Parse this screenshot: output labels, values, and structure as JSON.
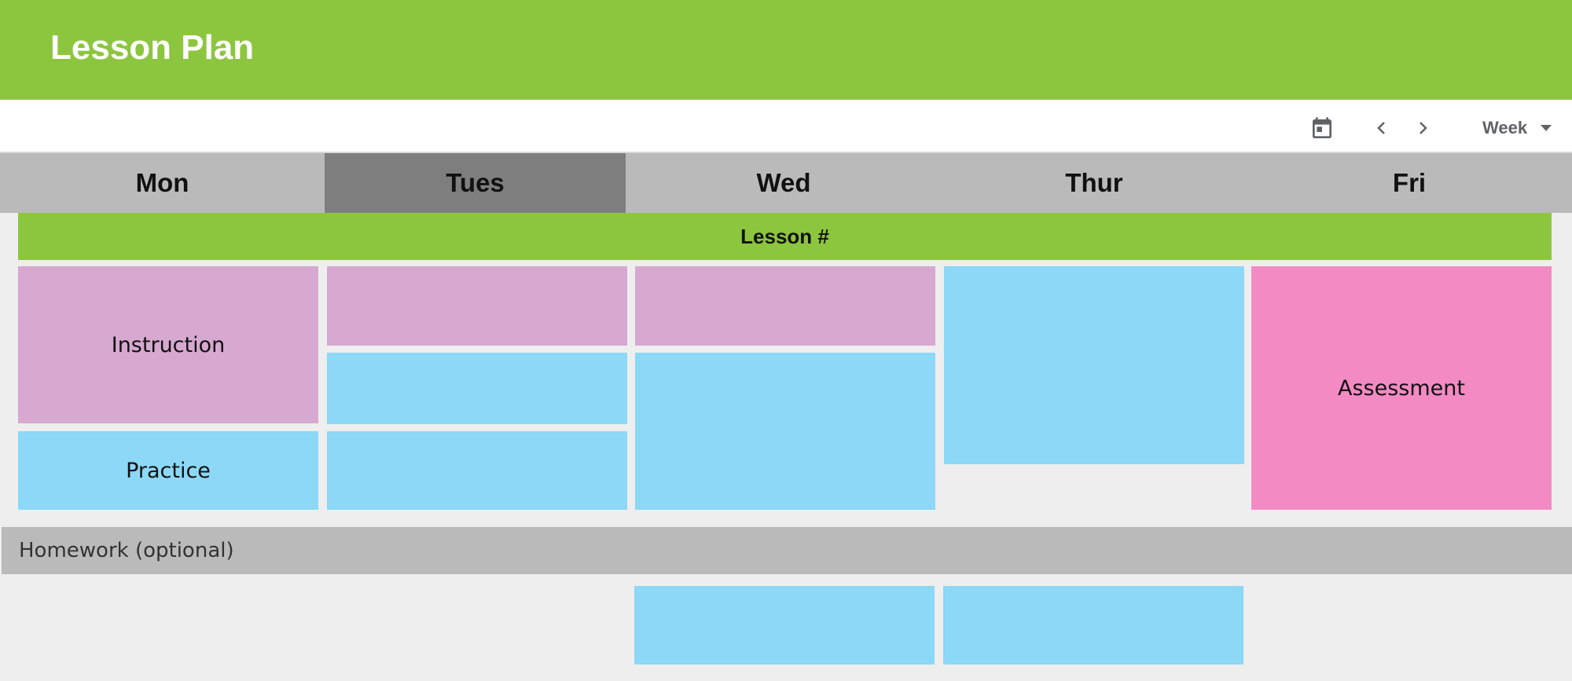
{
  "app": {
    "title": "Lesson Plan",
    "brand_color": "#8cc63f"
  },
  "toolbar": {
    "calendar_icon": "calendar-today-icon",
    "prev_icon": "chevron-left-icon",
    "next_icon": "chevron-right-icon",
    "view_label": "Week",
    "view_caret_icon": "caret-down-icon"
  },
  "days": [
    {
      "label": "Mon",
      "selected": false
    },
    {
      "label": "Tues",
      "selected": true
    },
    {
      "label": "Wed",
      "selected": false
    },
    {
      "label": "Thur",
      "selected": false
    },
    {
      "label": "Fri",
      "selected": false
    }
  ],
  "lesson_bar": {
    "label": "Lesson #"
  },
  "cards": {
    "mon_instruction": {
      "label": "Instruction",
      "color": "#d7a8d0"
    },
    "mon_practice": {
      "label": "Practice",
      "color": "#8cd8f6"
    },
    "tues_1": {
      "label": "",
      "color": "#d7a8d0"
    },
    "tues_2": {
      "label": "",
      "color": "#8cd8f6"
    },
    "tues_3": {
      "label": "",
      "color": "#8cd8f6"
    },
    "wed_1": {
      "label": "",
      "color": "#d7a8d0"
    },
    "wed_2": {
      "label": "",
      "color": "#8cd8f6"
    },
    "thur_1": {
      "label": "",
      "color": "#8cd8f6"
    },
    "fri_assessment": {
      "label": "Assessment",
      "color": "#f38ac4"
    },
    "hw_wed": {
      "label": "",
      "color": "#8cd8f6"
    },
    "hw_thur": {
      "label": "",
      "color": "#8cd8f6"
    }
  },
  "homework": {
    "label": "Homework (optional)"
  },
  "colors": {
    "day_row": "#bababa",
    "day_selected": "#7e7e7e",
    "board_bg": "#eeeeee"
  }
}
